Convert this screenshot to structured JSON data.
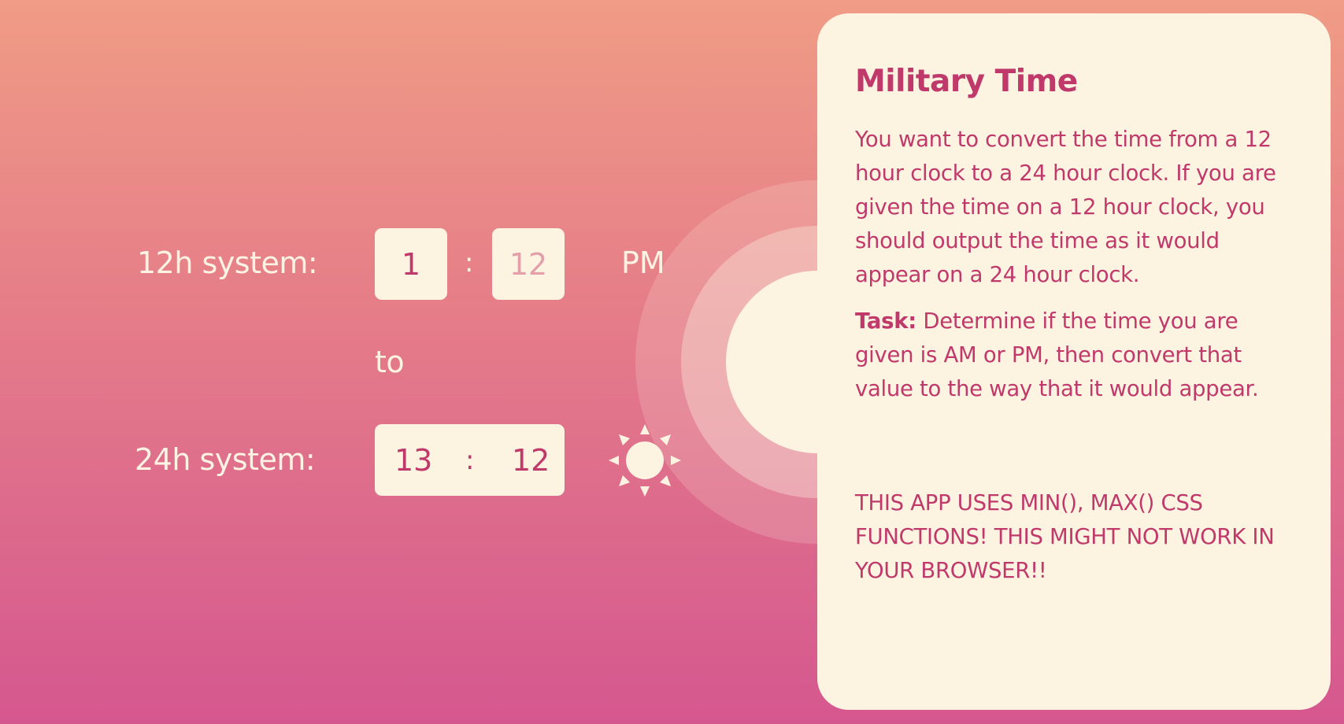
{
  "converter": {
    "label_12h": "12h system:",
    "label_24h": "24h system:",
    "connector": "to",
    "separator": ":",
    "input_12h_hour": "1",
    "input_12h_minute": "12",
    "meridiem": "PM",
    "output_24h_hour": "13",
    "output_24h_minute": "12",
    "daytime_icon": "sun-icon"
  },
  "info_card": {
    "title": "Military Time",
    "description": "You want to convert the time from a 12 hour clock to a 24 hour clock. If you are given the time on a 12 hour clock, you should output the time as it would appear on a 24 hour clock.",
    "task_label": "Task:",
    "task_text": " Determine if the time you are given is AM or PM, then convert that value to the way that it would appear.",
    "warning": "THIS APP USES MIN(), MAX() CSS FUNCTIONS! THIS MIGHT NOT WORK IN YOUR BROWSER!!"
  },
  "colors": {
    "gradient_top": "#f09c86",
    "gradient_bottom": "#d5578f",
    "card_background": "#fdf3e1",
    "accent_text": "#c0396b",
    "light_text": "#fdf3e3"
  }
}
